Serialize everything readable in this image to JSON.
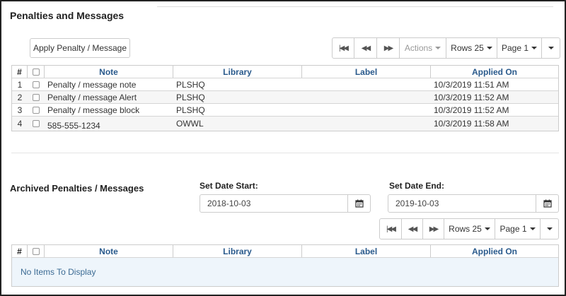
{
  "section1": {
    "title": "Penalties and Messages",
    "apply_button": "Apply Penalty / Message",
    "pager": {
      "actions_label": "Actions",
      "rows_label": "Rows 25",
      "page_label": "Page 1"
    },
    "columns": {
      "idx": "#",
      "note": "Note",
      "library": "Library",
      "label": "Label",
      "applied_on": "Applied On"
    },
    "rows": [
      {
        "idx": "1",
        "note": "Penalty / message note",
        "library": "PLSHQ",
        "label": "",
        "applied_on": "10/3/2019 11:51 AM"
      },
      {
        "idx": "2",
        "note": "Penalty / message Alert",
        "library": "PLSHQ",
        "label": "",
        "applied_on": "10/3/2019 11:52 AM"
      },
      {
        "idx": "3",
        "note": "Penalty / message block",
        "library": "PLSHQ",
        "label": "",
        "applied_on": "10/3/2019 11:52 AM"
      },
      {
        "idx": "4",
        "note": "585-555-1234",
        "library": "OWWL",
        "label": "",
        "applied_on": "10/3/2019 11:58 AM"
      }
    ]
  },
  "section2": {
    "title": "Archived Penalties / Messages",
    "date_start_label": "Set Date Start:",
    "date_start_value": "2018-10-03",
    "date_end_label": "Set Date End:",
    "date_end_value": "2019-10-03",
    "pager": {
      "rows_label": "Rows 25",
      "page_label": "Page 1"
    },
    "columns": {
      "idx": "#",
      "note": "Note",
      "library": "Library",
      "label": "Label",
      "applied_on": "Applied On"
    },
    "empty_message": "No Items To Display"
  },
  "icons": {
    "first": "first-page-icon",
    "prev": "previous-page-icon",
    "next": "next-page-icon",
    "calendar": "calendar-icon",
    "caret": "caret-down-icon"
  }
}
